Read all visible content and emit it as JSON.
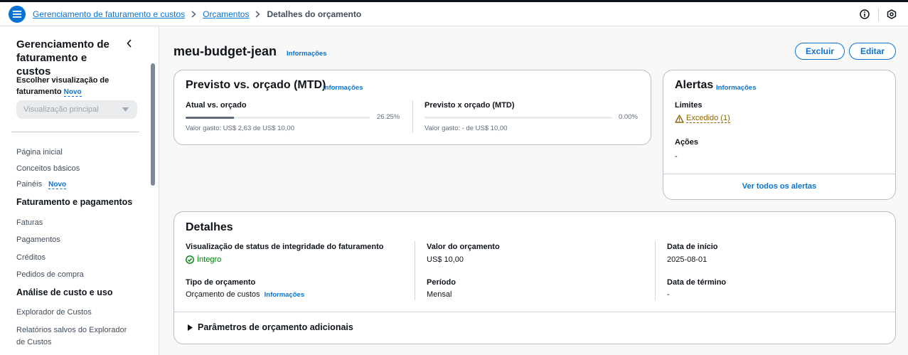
{
  "breadcrumbs": {
    "root": "Gerenciamento de faturamento e custos",
    "parent": "Orçamentos",
    "current": "Detalhes do orçamento"
  },
  "sidebar": {
    "title": "Gerenciamento de faturamento e custos",
    "choose_label": "Escolher visualização de faturamento",
    "choose_badge": "Novo",
    "select_value": "Visualização principal",
    "items": [
      {
        "label": "Página inicial"
      },
      {
        "label": "Conceitos básicos"
      },
      {
        "label": "Painéis",
        "badge": "Novo"
      }
    ],
    "section1": {
      "heading": "Faturamento e pagamentos",
      "items": [
        "Faturas",
        "Pagamentos",
        "Créditos",
        "Pedidos de compra"
      ]
    },
    "section2": {
      "heading": "Análise de custo e uso",
      "items": [
        "Explorador de Custos",
        "Relatórios salvos do Explorador de Custos"
      ]
    }
  },
  "page": {
    "title": "meu-budget-jean",
    "info": "Informações",
    "delete_label": "Excluir",
    "edit_label": "Editar"
  },
  "forecast": {
    "title": "Previsto vs. orçado (MTD)",
    "info": "Informações",
    "actual": {
      "label": "Atual vs. orçado",
      "percent_text": "26.25%",
      "percent": 26.25,
      "spent": "Valor gasto: US$ 2,63 de US$ 10,00"
    },
    "predicted": {
      "label": "Previsto x orçado (MTD)",
      "percent_text": "0.00%",
      "percent": 0,
      "spent": "Valor gasto: - de US$ 10,00"
    }
  },
  "alerts": {
    "title": "Alertas",
    "info": "Informações",
    "limits_label": "Limites",
    "limits_status": "Excedido (1)",
    "actions_label": "Ações",
    "actions_value": "-",
    "view_all": "Ver todos os alertas"
  },
  "details": {
    "title": "Detalhes",
    "health_label": "Visualização de status de integridade do faturamento",
    "health_value": "Íntegro",
    "type_label": "Tipo de orçamento",
    "type_value": "Orçamento de custos",
    "type_info": "Informações",
    "amount_label": "Valor do orçamento",
    "amount_value": "US$ 10,00",
    "period_label": "Período",
    "period_value": "Mensal",
    "start_label": "Data de início",
    "start_value": "2025-08-01",
    "end_label": "Data de término",
    "end_value": "-",
    "extra_params": "Parâmetros de orçamento adicionais"
  },
  "colors": {
    "accent": "#0972d3",
    "success": "#037f0c",
    "warning": "#8d6605"
  }
}
